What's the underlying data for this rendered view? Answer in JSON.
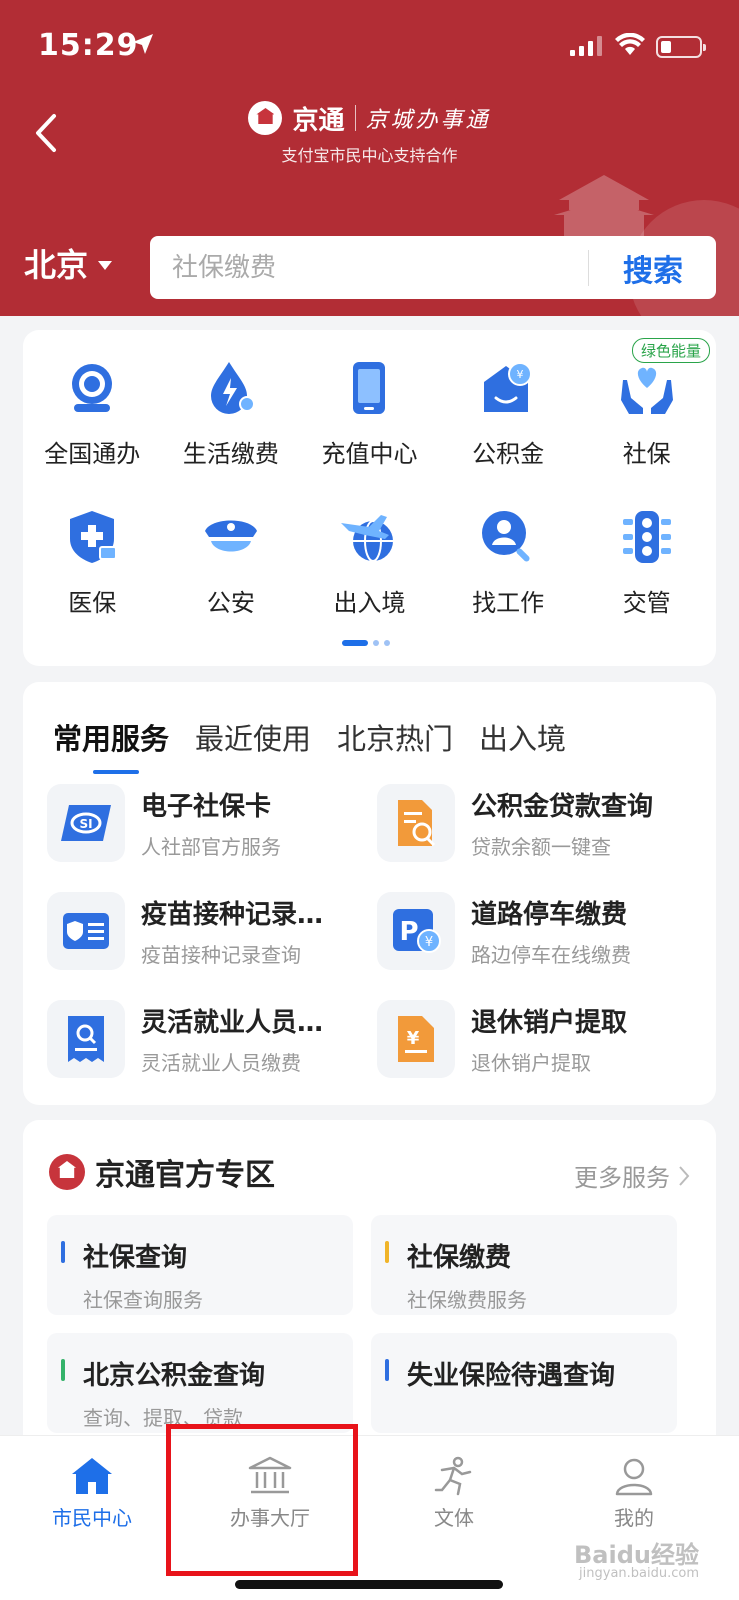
{
  "status": {
    "time": "15:29"
  },
  "header": {
    "brand_name": "京通",
    "brand_script": "京城办事通",
    "brand_sub": "支付宝市民中心支持合作"
  },
  "city": "北京",
  "search": {
    "placeholder": "社保缴费",
    "button": "搜索"
  },
  "grid": {
    "items": [
      {
        "label": "全国通办",
        "icon": "globe-service-icon"
      },
      {
        "label": "生活缴费",
        "icon": "water-drop-icon"
      },
      {
        "label": "充值中心",
        "icon": "phone-icon"
      },
      {
        "label": "公积金",
        "icon": "housing-fund-icon"
      },
      {
        "label": "社保",
        "icon": "heart-hands-icon",
        "badge": "绿色能量"
      },
      {
        "label": "医保",
        "icon": "medical-shield-icon"
      },
      {
        "label": "公安",
        "icon": "police-cap-icon"
      },
      {
        "label": "出入境",
        "icon": "plane-globe-icon"
      },
      {
        "label": "找工作",
        "icon": "person-search-icon"
      },
      {
        "label": "交管",
        "icon": "traffic-light-icon"
      }
    ],
    "page_count": 3,
    "active_page": 1
  },
  "services": {
    "tabs": [
      "常用服务",
      "最近使用",
      "北京热门",
      "出入境"
    ],
    "active_tab": 0,
    "items": [
      {
        "title": "电子社保卡",
        "sub": "人社部官方服务",
        "icon": "social-card-icon"
      },
      {
        "title": "公积金贷款查询",
        "sub": "贷款余额一键查",
        "icon": "doc-search-icon"
      },
      {
        "title": "疫苗接种记录…",
        "sub": "疫苗接种记录查询",
        "icon": "vaccine-card-icon"
      },
      {
        "title": "道路停车缴费",
        "sub": "路边停车在线缴费",
        "icon": "parking-icon"
      },
      {
        "title": "灵活就业人员…",
        "sub": "灵活就业人员缴费",
        "icon": "receipt-search-icon"
      },
      {
        "title": "退休销户提取",
        "sub": "退休销户提取",
        "icon": "yuan-doc-icon"
      }
    ]
  },
  "official": {
    "title": "京通官方专区",
    "more": "更多服务",
    "items": [
      {
        "title": "社保查询",
        "sub": "社保查询服务",
        "bar_color": "#2f6fe0"
      },
      {
        "title": "社保缴费",
        "sub": "社保缴费服务",
        "bar_color": "#f0b429"
      },
      {
        "title": "北京公积金查询",
        "sub": "查询、提取、贷款",
        "bar_color": "#34b36a"
      },
      {
        "title": "失业保险待遇查询",
        "sub": "",
        "bar_color": "#2f6fe0"
      }
    ]
  },
  "nav": {
    "items": [
      {
        "label": "市民中心",
        "icon": "home-icon",
        "active": true
      },
      {
        "label": "办事大厅",
        "icon": "bank-building-icon",
        "active": false
      },
      {
        "label": "文体",
        "icon": "running-person-icon",
        "active": false
      },
      {
        "label": "我的",
        "icon": "user-icon",
        "active": false
      }
    ]
  },
  "watermark": {
    "text": "Baidu经验",
    "url": "jingyan.baidu.com"
  },
  "colors": {
    "header_red": "#b22d35",
    "accent_blue": "#1e6fe8",
    "highlight_red": "#e8131a",
    "badge_green": "#2aa44a"
  }
}
